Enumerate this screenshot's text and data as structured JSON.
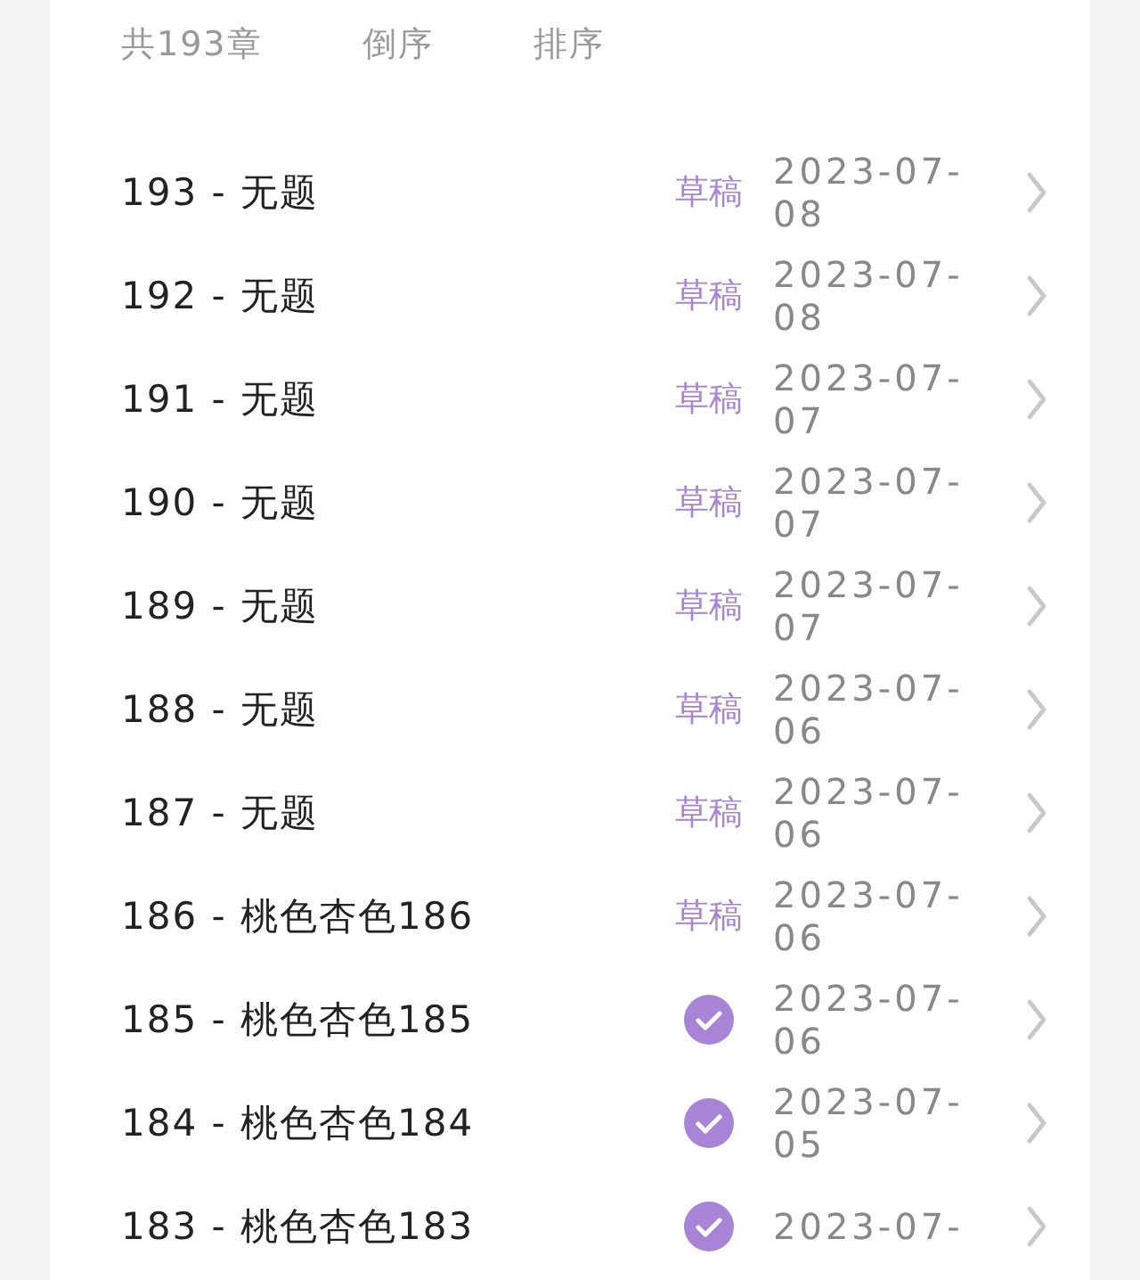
{
  "header": {
    "count": "共193章",
    "reverse": "倒序",
    "sort": "排序"
  },
  "chapters": [
    {
      "title": "193 - 无题",
      "kind": "draft",
      "status_label": "草稿",
      "date": "2023-07-08"
    },
    {
      "title": "192 - 无题",
      "kind": "draft",
      "status_label": "草稿",
      "date": "2023-07-08"
    },
    {
      "title": "191 - 无题",
      "kind": "draft",
      "status_label": "草稿",
      "date": "2023-07-07"
    },
    {
      "title": "190 - 无题",
      "kind": "draft",
      "status_label": "草稿",
      "date": "2023-07-07"
    },
    {
      "title": "189 - 无题",
      "kind": "draft",
      "status_label": "草稿",
      "date": "2023-07-07"
    },
    {
      "title": "188 - 无题",
      "kind": "draft",
      "status_label": "草稿",
      "date": "2023-07-06"
    },
    {
      "title": "187 - 无题",
      "kind": "draft",
      "status_label": "草稿",
      "date": "2023-07-06"
    },
    {
      "title": "186 - 桃色杏色186",
      "kind": "draft",
      "status_label": "草稿",
      "date": "2023-07-06"
    },
    {
      "title": "185 - 桃色杏色185",
      "kind": "published",
      "date": "2023-07-06"
    },
    {
      "title": "184 - 桃色杏色184",
      "kind": "published",
      "date": "2023-07-05"
    },
    {
      "title": "183 - 桃色杏色183",
      "kind": "published",
      "date": "2023-07-"
    }
  ]
}
